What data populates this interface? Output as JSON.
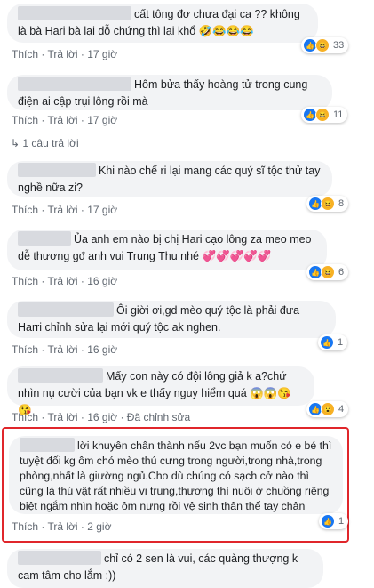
{
  "comments": [
    {
      "text": "cất tông đơ chưa đại ca ?? không là bà Hari bà lại dỗ chứng thì lại khổ 🤣😂😂😂",
      "like": "Thích",
      "reply": "Trả lời",
      "time": "17 giờ",
      "count": "33"
    },
    {
      "text": "Hôm bửa thấy hoàng tử trong cung điện ai cập trụi lông rồi mà",
      "like": "Thích",
      "reply": "Trả lời",
      "time": "17 giờ",
      "count": "11"
    },
    {
      "text": "Khi nào chế ri lại mang các quý sĩ tộc thử tay nghề nữa zi?",
      "like": "Thích",
      "reply": "Trả lời",
      "time": "17 giờ",
      "count": "8"
    },
    {
      "text": "Ủa anh em nào bị chị Hari cạo lông za meo meo dễ thương gđ anh vui Trung Thu nhé 💞💞💞💞💞",
      "like": "Thích",
      "reply": "Trả lời",
      "time": "16 giờ",
      "count": "6"
    },
    {
      "text": "Ôi giời ơi,gd mèo quý tộc là phải đưa Harri chỉnh sửa lại mới quý tộc ak nghen.",
      "like": "Thích",
      "reply": "Trả lời",
      "time": "16 giờ",
      "count": "1"
    },
    {
      "text": "Mấy con này có đội lông giả k a?chứ nhìn nụ cười của bạn vk e thấy nguy hiểm quá 😱😱😘😘",
      "like": "Thích",
      "reply": "Trả lời",
      "time": "16 giờ",
      "edited": "Đã chỉnh sửa",
      "count": "4"
    },
    {
      "text": "lời khuyên chân thành nếu 2vc bạn muốn có e bé thì tuyệt đối kg ôm chó mèo thú cưng trong người,trong nhà,trong phòng,nhất là giường ngủ.Cho dù chúng có sạch cở nào thì cũng là thú vật rất nhiều vi trung,thương thì nuôi ở chuồng riêng biệt ngắm nhìn hoặc ôm nựng rồi vệ sinh thân thể tay chân",
      "like": "Thích",
      "reply": "Trả lời",
      "time": "2 giờ",
      "count": "1"
    },
    {
      "text": "chỉ có 2 sen là vui, các quàng thượng k cam tâm cho lắm :))"
    }
  ],
  "replies_link": "1 câu trả lời",
  "colors": {
    "highlight": "#e0262b",
    "like": "#1877f2",
    "bubble": "#f2f3f5"
  }
}
